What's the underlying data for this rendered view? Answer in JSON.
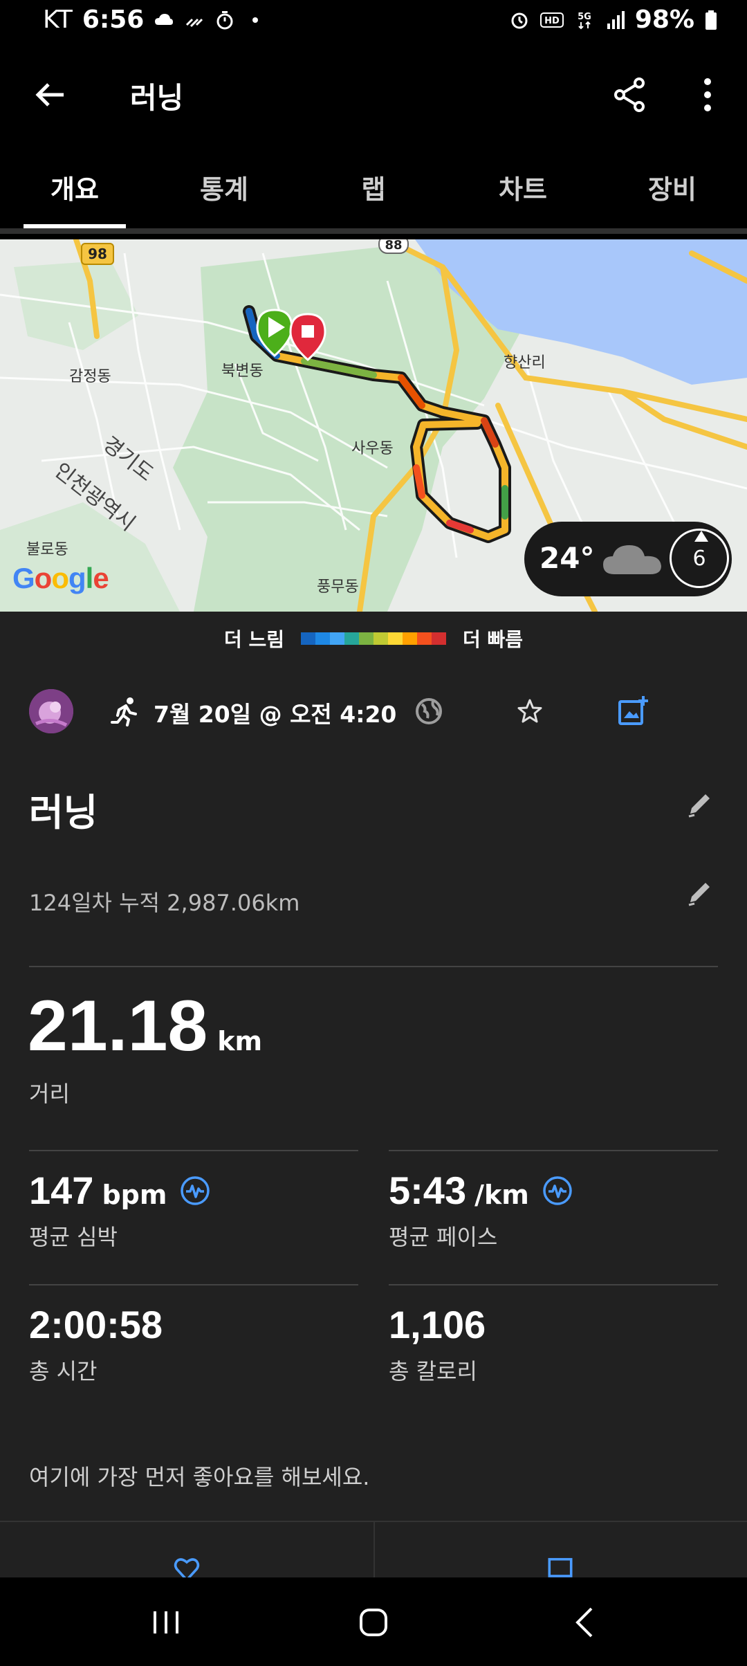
{
  "status_bar": {
    "carrier": "KT",
    "time": "6:56",
    "battery": "98%"
  },
  "app_bar": {
    "title": "러닝"
  },
  "tabs": [
    {
      "label": "개요",
      "active": true
    },
    {
      "label": "통계",
      "active": false
    },
    {
      "label": "랩",
      "active": false
    },
    {
      "label": "차트",
      "active": false
    },
    {
      "label": "장비",
      "active": false
    }
  ],
  "map": {
    "labels": {
      "gamjeong": "감정동",
      "bukbyeon": "북변동",
      "sawoo": "사우동",
      "hyangsan": "향산리",
      "gyeonggi": "경기도",
      "incheon": "인천광역시",
      "bullo": "불로동",
      "pungmu": "풍무동",
      "road_98": "98",
      "road_88": "88"
    },
    "google": "Google",
    "weather": {
      "temp": "24°",
      "wind": "6"
    }
  },
  "legend": {
    "slower": "더 느림",
    "faster": "더 빠름",
    "colors": [
      "#1565c0",
      "#1e88e5",
      "#42a5f5",
      "#26a69a",
      "#7cb342",
      "#c0ca33",
      "#fdd835",
      "#ffa000",
      "#f4511e",
      "#d32f2f"
    ]
  },
  "activity": {
    "date": "7월 20일 @ 오전 4:20",
    "name": "러닝",
    "subtitle": "124일차  누적 2,987.06km",
    "distance": {
      "value": "21.18",
      "unit": "km",
      "label": "거리"
    },
    "stats": {
      "heart_rate": {
        "value": "147",
        "unit": "bpm",
        "label": "평균 심박"
      },
      "pace": {
        "value": "5:43",
        "unit": "/km",
        "label": "평균 페이스"
      },
      "time": {
        "value": "2:00:58",
        "label": "총 시간"
      },
      "calories": {
        "value": "1,106",
        "label": "총 칼로리"
      }
    },
    "like_prompt": "여기에 가장 먼저 좋아요를 해보세요."
  },
  "colors": {
    "accent_blue": "#4a9bff",
    "content_bg": "#212121",
    "start_green": "#4caf1a",
    "stop_red": "#e0283c"
  }
}
